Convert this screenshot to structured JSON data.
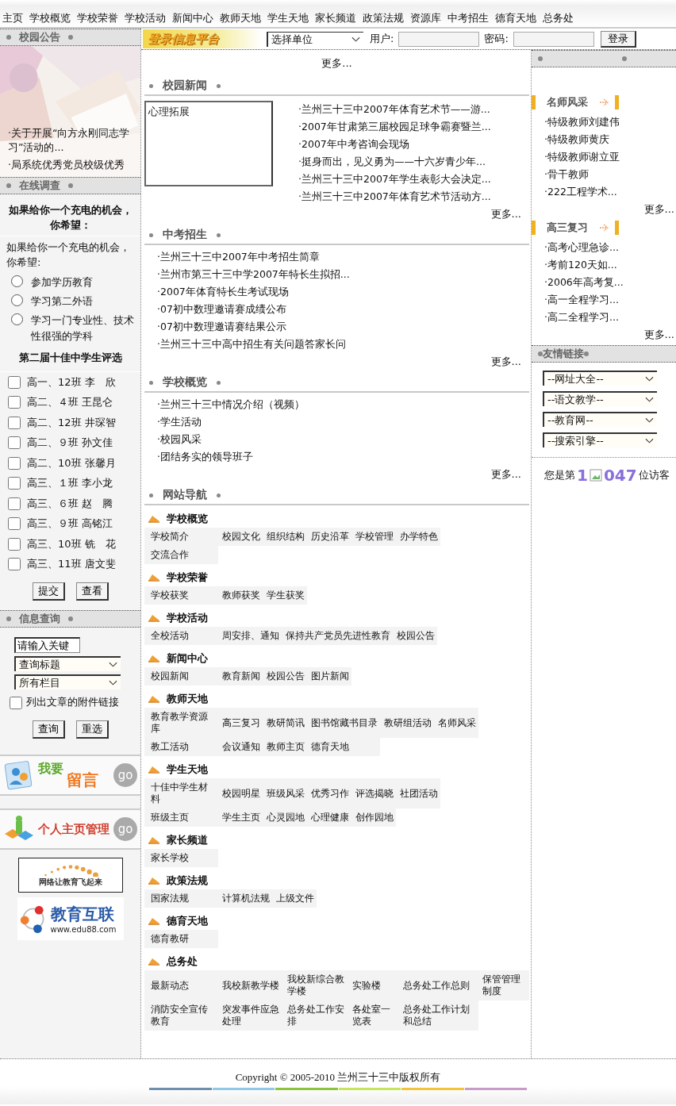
{
  "nav": [
    "主页",
    "学校概览",
    "学校荣誉",
    "学校活动",
    "新闻中心",
    "教师天地",
    "学生天地",
    "家长频道",
    "政策法规",
    "资源库",
    "中考招生",
    "德育天地",
    "总务处"
  ],
  "login": {
    "logo": "登录信息平台",
    "unit_select": "选择单位",
    "user_label": "用户:",
    "password_label": "密码:",
    "button": "登录"
  },
  "notice": {
    "title": "校园公告",
    "items": [
      "·关于开展“向方永刚同志学习”活动的...",
      "·局系统优秀党员校级优秀"
    ]
  },
  "survey": {
    "title": "在线调查",
    "heading": "如果给你一个充电的机会，你希望：",
    "question": "如果给你一个充电的机会，你希望:",
    "options": [
      {
        "label": "参加学历教育",
        "selected": false
      },
      {
        "label": "学习第二外语",
        "selected": false
      },
      {
        "label": "学习一门专业性、技术性很强的学科",
        "selected": false
      }
    ],
    "vote_title": "第二届十佳中学生评选",
    "candidates": [
      {
        "label": "高一、12班 李　欣",
        "checked": false
      },
      {
        "label": "高二、４班 王昆仑",
        "checked": false
      },
      {
        "label": "高二、12班 井琛智",
        "checked": false
      },
      {
        "label": "高二、９班 孙文佳",
        "checked": false
      },
      {
        "label": "高二、10班 张馨月",
        "checked": false
      },
      {
        "label": "高三、１班 李小龙",
        "checked": false
      },
      {
        "label": "高三、６班 赵　腾",
        "checked": false
      },
      {
        "label": "高三、９班 高铭江",
        "checked": false
      },
      {
        "label": "高三、10班 铣　花",
        "checked": false
      },
      {
        "label": "高三、11班 唐文斐",
        "checked": false
      }
    ],
    "buttons": [
      "提交",
      "查看"
    ]
  },
  "search": {
    "title": "信息查询",
    "value": "请输入关键",
    "selects": [
      "查询标题",
      "所有栏目"
    ],
    "attach_label": "列出文章的附件链接",
    "attach_checked": false,
    "buttons": [
      "查询",
      "重选"
    ]
  },
  "banners": [
    {
      "kind": "message",
      "text_a": "我要",
      "text_b": "留言",
      "go": "go"
    },
    {
      "kind": "homepage",
      "text_a": "个人主页管理",
      "go": "go"
    }
  ],
  "logos": [
    {
      "kind": "slogan",
      "text": "网络让教育飞起来"
    },
    {
      "kind": "edu",
      "text": "教育互联",
      "url": "www.edu88.com"
    }
  ],
  "more_top": "更多...",
  "news": {
    "title": "校园新闻",
    "image_alt": "心理拓展",
    "items": [
      "·兰州三十三中2007年体育艺术节——游...",
      "·2007年甘肃第三届校园足球争霸赛暨兰...",
      "·2007年中考咨询会现场",
      "·挺身而出，见义勇为——十六岁青少年...",
      "·兰州三十三中2007年学生表彰大会决定...",
      "·兰州三十三中2007年体育艺术节活动方..."
    ],
    "more": "更多..."
  },
  "sections": [
    {
      "title": "中考招生",
      "items": [
        "·兰州三十三中2007年中考招生简章",
        "·兰州市第三十三中学2007年特长生拟招...",
        "·2007年体育特长生考试现场",
        "·07初中数理邀请赛成绩公布",
        "·07初中数理邀请赛结果公示",
        "·兰州三十三中高中招生有关问题答家长问"
      ],
      "more": "更多..."
    },
    {
      "title": "学校概览",
      "items": [
        "·兰州三十三中情况介绍（视频）",
        "·学生活动",
        "·校园风采",
        "·团结务实的领导班子"
      ],
      "more": "更多..."
    }
  ],
  "site_nav": {
    "title": "网站导航",
    "groups": [
      {
        "title": "学校概览",
        "rows": [
          [
            "学校简介",
            "校园文化",
            "组织结构",
            "历史沿革",
            "学校管理",
            "办学特色"
          ],
          [
            "交流合作"
          ]
        ]
      },
      {
        "title": "学校荣誉",
        "rows": [
          [
            "学校获奖",
            "教师获奖",
            "学生获奖"
          ]
        ]
      },
      {
        "title": "学校活动",
        "rows": [
          [
            "全校活动",
            "周安排、通知",
            "保持共产党员先进性教育",
            "校园公告"
          ]
        ]
      },
      {
        "title": "新闻中心",
        "rows": [
          [
            "校园新闻",
            "教育新闻",
            "校园公告",
            "图片新闻"
          ]
        ]
      },
      {
        "title": "教师天地",
        "rows": [
          [
            "教育教学资源库",
            "高三复习",
            "教研简讯",
            "图书馆藏书目录",
            "教研组活动",
            "名师风采"
          ],
          [
            "教工活动",
            "会议通知",
            "教师主页",
            "德育天地"
          ]
        ]
      },
      {
        "title": "学生天地",
        "rows": [
          [
            "十佳中学生材料",
            "校园明星",
            "班级风采",
            "优秀习作",
            "评选揭晓",
            "社团活动"
          ],
          [
            "班级主页",
            "学生主页",
            "心灵园地",
            "心理健康",
            "创作园地"
          ]
        ]
      },
      {
        "title": "家长频道",
        "rows": [
          [
            "家长学校"
          ]
        ]
      },
      {
        "title": "政策法规",
        "rows": [
          [
            "国家法规",
            "计算机法规",
            "上级文件"
          ]
        ]
      },
      {
        "title": "德育天地",
        "rows": [
          [
            "德育教研"
          ]
        ]
      },
      {
        "title": "总务处",
        "rows": [
          [
            "最新动态",
            "我校新教学楼",
            "我校新综合教学楼",
            "实验楼",
            "总务处工作总则",
            "保管管理制度"
          ],
          [
            "消防安全宣传教育",
            "突发事件应急处理",
            "总务处工作安排",
            "各处室一览表",
            "总务处工作计划和总结"
          ]
        ]
      }
    ]
  },
  "right": {
    "lists": [
      {
        "title": "名师风采",
        "items": [
          "·特级教师刘建伟",
          "·特级教师黄庆",
          "·特级教师谢立亚",
          "·骨干教师",
          "·222工程学术..."
        ],
        "more": "更多..."
      },
      {
        "title": "高三复习",
        "items": [
          "·高考心理急诊...",
          "·考前120天如...",
          "·2006年高考复...",
          "·高一全程学习...",
          "·高二全程学习..."
        ],
        "more": "更多..."
      }
    ],
    "links_title": "友情链接",
    "link_selects": [
      "--网址大全--",
      "--语文教学--",
      "--教育网--",
      "--搜索引擎--"
    ],
    "visitor": {
      "prefix": "您是第",
      "digits_a": "1",
      "digits_b": "047",
      "suffix": "位访客"
    }
  },
  "footer": {
    "copyright": "Copyright © 2005-2010 兰州三十三中版权所有"
  }
}
